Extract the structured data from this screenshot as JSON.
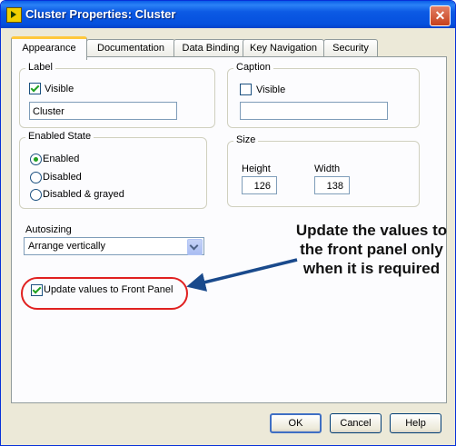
{
  "window": {
    "title": "Cluster Properties: Cluster",
    "close_symbol": "✕"
  },
  "tabs": [
    {
      "label": "Appearance",
      "active": true
    },
    {
      "label": "Documentation",
      "active": false
    },
    {
      "label": "Data Binding",
      "active": false
    },
    {
      "label": "Key Navigation",
      "active": false
    },
    {
      "label": "Security",
      "active": false
    }
  ],
  "label_group": {
    "title": "Label",
    "visible_label": "Visible",
    "visible_checked": true,
    "value": "Cluster"
  },
  "caption_group": {
    "title": "Caption",
    "visible_label": "Visible",
    "visible_checked": false,
    "value": ""
  },
  "enabled_state": {
    "title": "Enabled State",
    "options": [
      {
        "label": "Enabled",
        "selected": true
      },
      {
        "label": "Disabled",
        "selected": false
      },
      {
        "label": "Disabled & grayed",
        "selected": false
      }
    ]
  },
  "size_group": {
    "title": "Size",
    "height_label": "Height",
    "width_label": "Width",
    "height_value": "126",
    "width_value": "138"
  },
  "autosizing": {
    "label": "Autosizing",
    "value": "Arrange vertically"
  },
  "update_values": {
    "label": "Update values to Front Panel",
    "checked": true
  },
  "annotation": {
    "text": "Update the values to the front panel only when it is required",
    "color": "#1a4a8c",
    "highlight_color": "#e02020"
  },
  "buttons": {
    "ok": "OK",
    "cancel": "Cancel",
    "help": "Help"
  }
}
